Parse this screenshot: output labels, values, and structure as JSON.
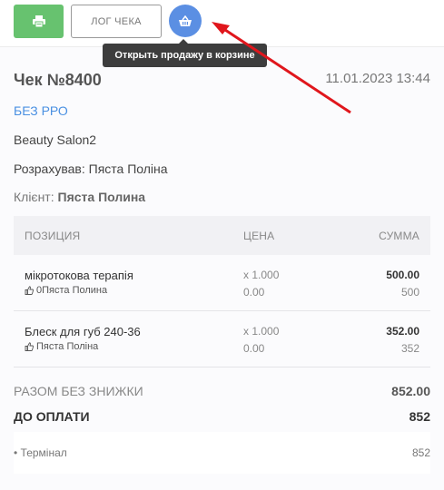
{
  "toolbar": {
    "log_label": "ЛОГ ЧЕКА",
    "print_icon": "printer-icon",
    "basket_icon": "basket-icon",
    "tooltip": "Открыть продажу в корзине"
  },
  "receipt": {
    "title": "Чек №8400",
    "date": "11.01.2023 13:44",
    "no_rro": "БЕЗ РРО",
    "salon": "Beauty Salon2",
    "cashier": "Розрахував: Пяста Поліна",
    "client_label": "Клієнт:",
    "client_name": "Пяста Полина"
  },
  "table": {
    "headers": {
      "position": "ПОЗИЦИЯ",
      "price": "ЦЕНА",
      "sum": "СУММА"
    },
    "rows": [
      {
        "name": "мікротокова терапія",
        "master": "0Пяста Полина",
        "qty": "x 1.000",
        "discount": "0.00",
        "sum": "500.00",
        "base": "500"
      },
      {
        "name": "Блеск для губ 240-36",
        "master": "Пяста Поліна",
        "qty": "x 1.000",
        "discount": "0.00",
        "sum": "352.00",
        "base": "352"
      }
    ]
  },
  "totals": {
    "without_discount_label": "РАЗОМ БЕЗ ЗНИЖКИ",
    "without_discount_value": "852.00",
    "to_pay_label": "ДО ОПЛАТИ",
    "to_pay_value": "852",
    "payment_label": "• Термінал",
    "payment_value": "852"
  },
  "colors": {
    "print_button": "#67c26f",
    "basket_button": "#5b8fe3",
    "no_rro": "#4a90e2",
    "annotation_arrow": "#e0161c"
  }
}
